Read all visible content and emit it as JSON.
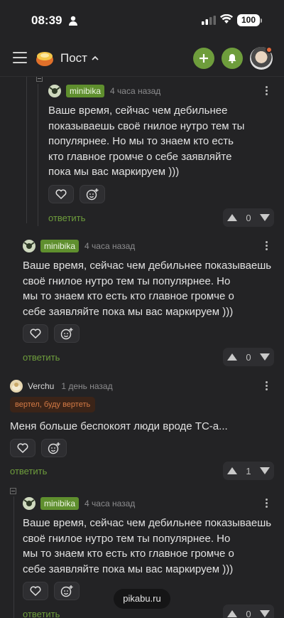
{
  "status": {
    "time": "08:39",
    "battery": "100"
  },
  "header": {
    "title": "Пост"
  },
  "comments": [
    {
      "user": "minibika",
      "time": "4 часа назад",
      "text_lines": [
        "Ваше время, сейчас чем дебильнее",
        "показываешь своё гнилое нутро тем ты",
        "популярнее. Но мы то знаем кто есть",
        "кто главное громче о себе заявляйте",
        "пока мы вас маркируем )))"
      ],
      "reply": "ответить",
      "score": "0"
    },
    {
      "user": "minibika",
      "time": "4 часа назад",
      "text_lines": [
        "Ваше время, сейчас чем дебильнее показываешь",
        "своё гнилое нутро тем ты популярнее. Но",
        "мы то знаем кто есть кто главное громче о",
        "себе заявляйте пока мы вас маркируем )))"
      ],
      "reply": "ответить",
      "score": "0"
    },
    {
      "user": "Verchu",
      "time": "1 день назад",
      "tag": "вертел, буду вертеть",
      "text_lines": [
        "Меня больше беспокоят люди вроде ТС-а..."
      ],
      "reply": "ответить",
      "score": "1"
    },
    {
      "user": "minibika",
      "time": "4 часа назад",
      "text_lines": [
        "Ваше время, сейчас чем дебильнее показываешь",
        "своё гнилое нутро тем ты популярнее. Но",
        "мы то знаем кто есть кто главное громче о",
        "себе заявляйте пока мы вас маркируем )))"
      ],
      "reply": "ответить",
      "score": "0"
    }
  ],
  "footer": {
    "site": "pikabu.ru"
  },
  "colors": {
    "background": "#232325",
    "accent": "#6e9d3c",
    "tag_bg": "#3b2418",
    "tag_text": "#d47a45"
  },
  "icons": [
    "menu-icon",
    "pikabu-logo",
    "chevron-up-icon",
    "plus-icon",
    "bell-icon",
    "heart-icon",
    "emoji-add-icon",
    "arrow-up-icon",
    "arrow-down-icon",
    "more-vertical-icon"
  ]
}
